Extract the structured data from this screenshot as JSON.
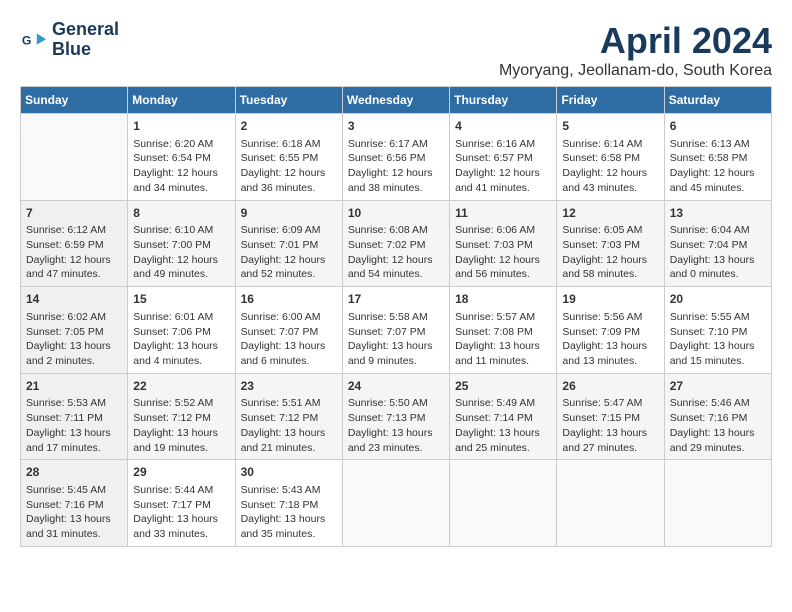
{
  "logo": {
    "line1": "General",
    "line2": "Blue"
  },
  "title": "April 2024",
  "subtitle": "Myoryang, Jeollanam-do, South Korea",
  "days_header": [
    "Sunday",
    "Monday",
    "Tuesday",
    "Wednesday",
    "Thursday",
    "Friday",
    "Saturday"
  ],
  "weeks": [
    [
      {
        "day": "",
        "info": ""
      },
      {
        "day": "1",
        "info": "Sunrise: 6:20 AM\nSunset: 6:54 PM\nDaylight: 12 hours\nand 34 minutes."
      },
      {
        "day": "2",
        "info": "Sunrise: 6:18 AM\nSunset: 6:55 PM\nDaylight: 12 hours\nand 36 minutes."
      },
      {
        "day": "3",
        "info": "Sunrise: 6:17 AM\nSunset: 6:56 PM\nDaylight: 12 hours\nand 38 minutes."
      },
      {
        "day": "4",
        "info": "Sunrise: 6:16 AM\nSunset: 6:57 PM\nDaylight: 12 hours\nand 41 minutes."
      },
      {
        "day": "5",
        "info": "Sunrise: 6:14 AM\nSunset: 6:58 PM\nDaylight: 12 hours\nand 43 minutes."
      },
      {
        "day": "6",
        "info": "Sunrise: 6:13 AM\nSunset: 6:58 PM\nDaylight: 12 hours\nand 45 minutes."
      }
    ],
    [
      {
        "day": "7",
        "info": "Sunrise: 6:12 AM\nSunset: 6:59 PM\nDaylight: 12 hours\nand 47 minutes."
      },
      {
        "day": "8",
        "info": "Sunrise: 6:10 AM\nSunset: 7:00 PM\nDaylight: 12 hours\nand 49 minutes."
      },
      {
        "day": "9",
        "info": "Sunrise: 6:09 AM\nSunset: 7:01 PM\nDaylight: 12 hours\nand 52 minutes."
      },
      {
        "day": "10",
        "info": "Sunrise: 6:08 AM\nSunset: 7:02 PM\nDaylight: 12 hours\nand 54 minutes."
      },
      {
        "day": "11",
        "info": "Sunrise: 6:06 AM\nSunset: 7:03 PM\nDaylight: 12 hours\nand 56 minutes."
      },
      {
        "day": "12",
        "info": "Sunrise: 6:05 AM\nSunset: 7:03 PM\nDaylight: 12 hours\nand 58 minutes."
      },
      {
        "day": "13",
        "info": "Sunrise: 6:04 AM\nSunset: 7:04 PM\nDaylight: 13 hours\nand 0 minutes."
      }
    ],
    [
      {
        "day": "14",
        "info": "Sunrise: 6:02 AM\nSunset: 7:05 PM\nDaylight: 13 hours\nand 2 minutes."
      },
      {
        "day": "15",
        "info": "Sunrise: 6:01 AM\nSunset: 7:06 PM\nDaylight: 13 hours\nand 4 minutes."
      },
      {
        "day": "16",
        "info": "Sunrise: 6:00 AM\nSunset: 7:07 PM\nDaylight: 13 hours\nand 6 minutes."
      },
      {
        "day": "17",
        "info": "Sunrise: 5:58 AM\nSunset: 7:07 PM\nDaylight: 13 hours\nand 9 minutes."
      },
      {
        "day": "18",
        "info": "Sunrise: 5:57 AM\nSunset: 7:08 PM\nDaylight: 13 hours\nand 11 minutes."
      },
      {
        "day": "19",
        "info": "Sunrise: 5:56 AM\nSunset: 7:09 PM\nDaylight: 13 hours\nand 13 minutes."
      },
      {
        "day": "20",
        "info": "Sunrise: 5:55 AM\nSunset: 7:10 PM\nDaylight: 13 hours\nand 15 minutes."
      }
    ],
    [
      {
        "day": "21",
        "info": "Sunrise: 5:53 AM\nSunset: 7:11 PM\nDaylight: 13 hours\nand 17 minutes."
      },
      {
        "day": "22",
        "info": "Sunrise: 5:52 AM\nSunset: 7:12 PM\nDaylight: 13 hours\nand 19 minutes."
      },
      {
        "day": "23",
        "info": "Sunrise: 5:51 AM\nSunset: 7:12 PM\nDaylight: 13 hours\nand 21 minutes."
      },
      {
        "day": "24",
        "info": "Sunrise: 5:50 AM\nSunset: 7:13 PM\nDaylight: 13 hours\nand 23 minutes."
      },
      {
        "day": "25",
        "info": "Sunrise: 5:49 AM\nSunset: 7:14 PM\nDaylight: 13 hours\nand 25 minutes."
      },
      {
        "day": "26",
        "info": "Sunrise: 5:47 AM\nSunset: 7:15 PM\nDaylight: 13 hours\nand 27 minutes."
      },
      {
        "day": "27",
        "info": "Sunrise: 5:46 AM\nSunset: 7:16 PM\nDaylight: 13 hours\nand 29 minutes."
      }
    ],
    [
      {
        "day": "28",
        "info": "Sunrise: 5:45 AM\nSunset: 7:16 PM\nDaylight: 13 hours\nand 31 minutes."
      },
      {
        "day": "29",
        "info": "Sunrise: 5:44 AM\nSunset: 7:17 PM\nDaylight: 13 hours\nand 33 minutes."
      },
      {
        "day": "30",
        "info": "Sunrise: 5:43 AM\nSunset: 7:18 PM\nDaylight: 13 hours\nand 35 minutes."
      },
      {
        "day": "",
        "info": ""
      },
      {
        "day": "",
        "info": ""
      },
      {
        "day": "",
        "info": ""
      },
      {
        "day": "",
        "info": ""
      }
    ]
  ]
}
